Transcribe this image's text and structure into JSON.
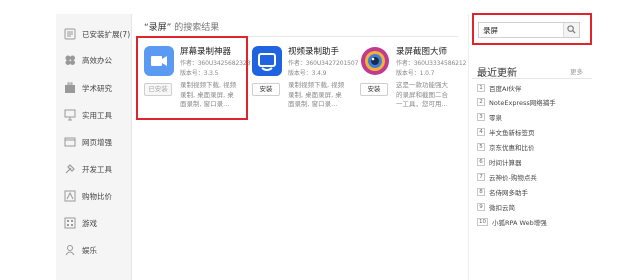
{
  "sidebar": {
    "items": [
      {
        "label": "已安装扩展(7)",
        "icon": "installed-icon"
      },
      {
        "label": "高效办公",
        "icon": "office-icon"
      },
      {
        "label": "学术研究",
        "icon": "research-icon"
      },
      {
        "label": "实用工具",
        "icon": "tools-icon"
      },
      {
        "label": "网页增强",
        "icon": "webpage-icon"
      },
      {
        "label": "开发工具",
        "icon": "dev-tools-icon"
      },
      {
        "label": "购物比价",
        "icon": "shopping-icon"
      },
      {
        "label": "游戏",
        "icon": "game-icon"
      },
      {
        "label": "娱乐",
        "icon": "entertainment-icon"
      }
    ]
  },
  "results": {
    "title_keyword": "“录屏”",
    "title_suffix": " 的搜索结果",
    "apps": [
      {
        "name": "屏幕录制神器",
        "author": "作者：360U3425682323",
        "version": "版本号：3.3.5",
        "desc": [
          "录制视频下载, 视频",
          "录制, 桌面录屏, 桌",
          "面录制, 窗口录..."
        ],
        "button": "已安装",
        "logo_color": "#5b9af2"
      },
      {
        "name": "视频录制助手",
        "author": "作者：360U3427201507",
        "version": "版本号：3.4.9",
        "desc": [
          "录制视频下载, 视频",
          "录制, 桌面录屏, 桌",
          "面录制, 窗口录..."
        ],
        "button": "安装",
        "logo_color": "#1f63e0"
      },
      {
        "name": "录屏截图大师",
        "author": "作者：360U3334586212",
        "version": "版本号：1.0.7",
        "desc": [
          "这是一款功能强大",
          "的录屏和截图二合",
          "一工具，您可用..."
        ],
        "button": "安装",
        "logo_color": "#c03b8e"
      }
    ]
  },
  "search": {
    "value": "录屏",
    "button_icon": "search-icon"
  },
  "updates": {
    "title": "最近更新",
    "more": "更多",
    "items": [
      {
        "num": "1",
        "label": "百度AI伙伴"
      },
      {
        "num": "2",
        "label": "NoteExpress网络捕手"
      },
      {
        "num": "3",
        "label": "零泉"
      },
      {
        "num": "4",
        "label": "半文鱼新标签页"
      },
      {
        "num": "5",
        "label": "京东优惠和比价"
      },
      {
        "num": "6",
        "label": "时间计算器"
      },
      {
        "num": "7",
        "label": "云神价-购物点兵"
      },
      {
        "num": "8",
        "label": "名侍网多助手"
      },
      {
        "num": "9",
        "label": "微扣云简"
      },
      {
        "num": "10",
        "label": "小狐RPA Web增强"
      }
    ]
  },
  "colors": {
    "highlight": "#e0242c"
  }
}
